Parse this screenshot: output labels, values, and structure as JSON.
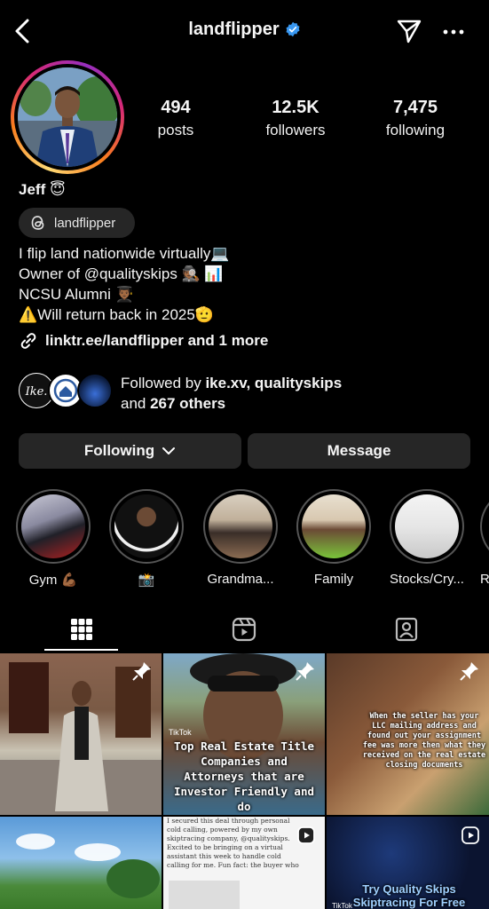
{
  "header": {
    "username": "landflipper",
    "verified": true
  },
  "profile": {
    "stats": [
      {
        "value": "494",
        "label": "posts"
      },
      {
        "value": "12.5K",
        "label": "followers"
      },
      {
        "value": "7,475",
        "label": "following"
      }
    ],
    "name": "Jeff 😇",
    "threads_handle": "landflipper",
    "bio_lines": [
      "I flip land nationwide virtually💻",
      "Owner of  @qualityskips 🕵🏾 📊",
      "NCSU Alumni 👨🏾‍🎓",
      "⚠️Will return back in 2025🫡"
    ],
    "link_text": "linktr.ee/landflipper and 1 more",
    "followed_by_prefix": "Followed by ",
    "followed_by_names": "ike.xv, qualityskips",
    "followed_by_and": "and ",
    "followed_by_others": "267 others"
  },
  "actions": {
    "following_label": "Following",
    "message_label": "Message"
  },
  "highlights": [
    {
      "label": "Gym 💪🏾"
    },
    {
      "label": "📸"
    },
    {
      "label": "Grandma..."
    },
    {
      "label": "Family"
    },
    {
      "label": "Stocks/Cry..."
    },
    {
      "label": "R"
    }
  ],
  "tabs": [
    "posts-grid",
    "reels",
    "tagged"
  ],
  "posts": [
    {
      "caption": "",
      "pinned": true,
      "type": "photo"
    },
    {
      "caption": "Top Real Estate Title Companies and Attorneys that are Investor Friendly and do",
      "badge": "TikTok",
      "pinned": true,
      "type": "video"
    },
    {
      "caption": "When the seller has your LLC mailing address and found out your assignment fee was more then what they received on the real estate closing documents",
      "pinned": true,
      "type": "video"
    },
    {
      "caption": "",
      "type": "photo"
    },
    {
      "caption": "I secured this deal through personal cold calling, powered by my own skiptracing company, @qualityskips. Excited to be bringing on a virtual assistant this week to handle cold calling for me. Fun fact: the buyer who purchased the property is my attorney who oversees all my North Carolina closings.",
      "type": "reel"
    },
    {
      "caption": "Try Quality Skips Skiptracing For Free",
      "badge": "TikTok",
      "type": "reel"
    }
  ],
  "colors": {
    "background": "#000000",
    "button_bg": "#262626",
    "verified": "#3897f0"
  }
}
